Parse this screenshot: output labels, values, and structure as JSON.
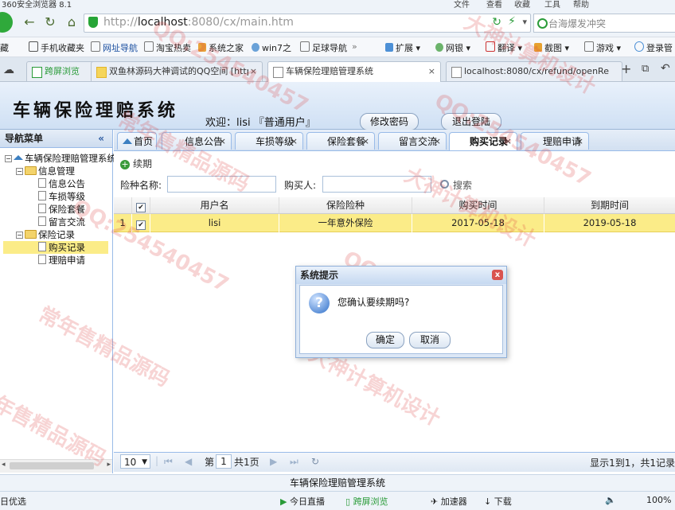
{
  "browser": {
    "title": "360安全浏览器 8.1",
    "menu": [
      "文件",
      "查看",
      "收藏",
      "工具",
      "帮助"
    ],
    "url_prefix": "http://",
    "url_host": "localhost",
    "url_rest": ":8080/cx/main.htm",
    "search_placeholder": "台海爆发冲突",
    "bookmarks": [
      "藏",
      "手机收藏夹",
      "网址导航",
      "淘宝热卖",
      "系统之家",
      "win7之",
      "足球导航",
      "扩展",
      "网银",
      "翻译",
      "截图",
      "游戏",
      "登录管"
    ],
    "tabs": [
      "跨屏浏览",
      "双鱼林源码大神调试的QQ空间 [http",
      "车辆保险理赔管理系统",
      "localhost:8080/cx/refund/openRe"
    ]
  },
  "app": {
    "title": "车辆保险理赔系统",
    "welcome": "欢迎：lisi 『普通用户』",
    "change_password": "修改密码",
    "logout": "退出登陆"
  },
  "nav": {
    "header": "导航菜单",
    "collapse": "«",
    "root": "车辆保险理赔管理系统",
    "groups": [
      {
        "label": "信息管理",
        "items": [
          "信息公告",
          "车损等级",
          "保险套餐",
          "留言交流"
        ]
      },
      {
        "label": "保险记录",
        "items": [
          "购买记录",
          "理赔申请"
        ]
      }
    ]
  },
  "tabs": [
    "首页",
    "信息公告",
    "车损等级",
    "保险套餐",
    "留言交流",
    "购买记录",
    "理赔申请"
  ],
  "toolbar": {
    "renew": "续期",
    "insurance_label": "险种名称:",
    "buyer_label": "购买人:",
    "search": "搜索"
  },
  "grid": {
    "columns": [
      "用户名",
      "保险险种",
      "购买时间",
      "到期时间"
    ],
    "rows": [
      {
        "index": "1",
        "user": "lisi",
        "insurance": "一年意外保险",
        "buy_time": "2017-05-18",
        "expire_time": "2019-05-18"
      }
    ]
  },
  "pager": {
    "page_size": "10",
    "page_prefix": "第",
    "page": "1",
    "page_suffix": "共1页",
    "summary": "显示1到1，共1记录"
  },
  "footer": "车辆保险理赔管理系统",
  "statusbar": [
    "日优选",
    "今日直播",
    "跨屏浏览",
    "加速器",
    "下载",
    "100%"
  ],
  "dialog": {
    "title": "系统提示",
    "close": "x",
    "message": "您确认要续期吗?",
    "ok": "确定",
    "cancel": "取消"
  },
  "watermarks": [
    "QQ:254540457",
    "常年售精品源码",
    "大神计算机设计",
    "QQ:254540457",
    "常年售精品源码",
    "大神计算机设计",
    "QQ:254540457",
    "常年售精品源码",
    "大神计算机设计",
    "QQ:254540457"
  ]
}
